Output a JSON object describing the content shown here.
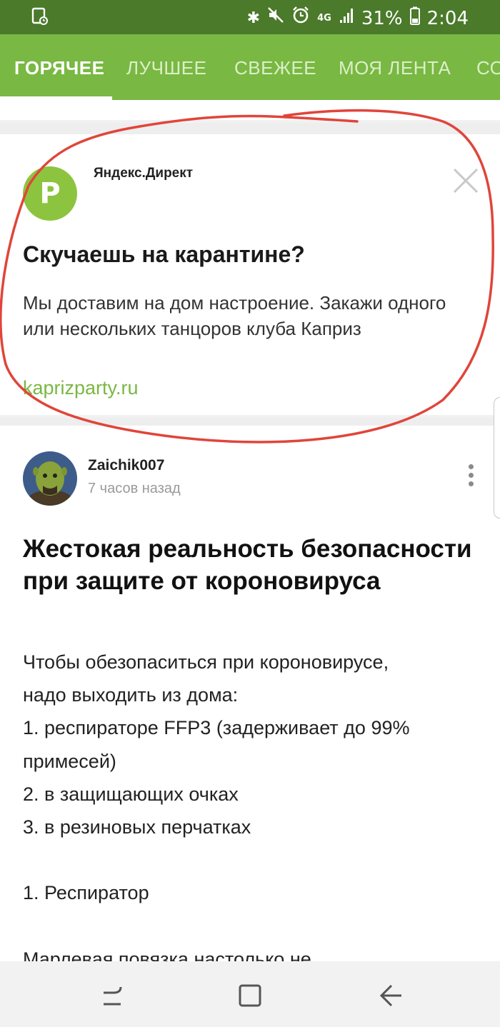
{
  "status_bar": {
    "network": "4G",
    "battery": "31%",
    "time": "2:04",
    "icons": [
      "gallery-icon",
      "bluetooth-icon",
      "mute-icon",
      "alarm-icon",
      "signal-icon",
      "battery-icon"
    ]
  },
  "tabs": [
    {
      "label": "ГОРЯЧЕЕ",
      "active": true
    },
    {
      "label": "ЛУЧШЕЕ",
      "active": false
    },
    {
      "label": "СВЕЖЕЕ",
      "active": false
    },
    {
      "label": "МОЯ ЛЕНТА",
      "active": false
    },
    {
      "label": "СО",
      "active": false
    }
  ],
  "ad": {
    "logo_letter": "P",
    "source": "Яндекс.Директ",
    "title": "Скучаешь на карантине?",
    "text": "Мы доставим на дом настроение. Закажи одного или нескольких танцоров клуба Каприз",
    "link": "kaprizparty.ru"
  },
  "post": {
    "author": "Zaichik007",
    "time": "7 часов назад",
    "title": "Жестокая реальность безопасности при защите от короновируса",
    "body": "Чтобы обезопаситься при короновирусе,\nнадо выходить из дома:\n1. респираторе FFP3 (задерживает до 99%\nпримесей)\n2. в защищающих очках\n3. в резиновых перчатках\n\n1. Респиратор\n\nМарлевая повязка настолько не"
  },
  "colors": {
    "status_bar": "#4a7a2a",
    "tab_bar": "#79b843",
    "link": "#79b843",
    "annotation": "#e0453a"
  }
}
